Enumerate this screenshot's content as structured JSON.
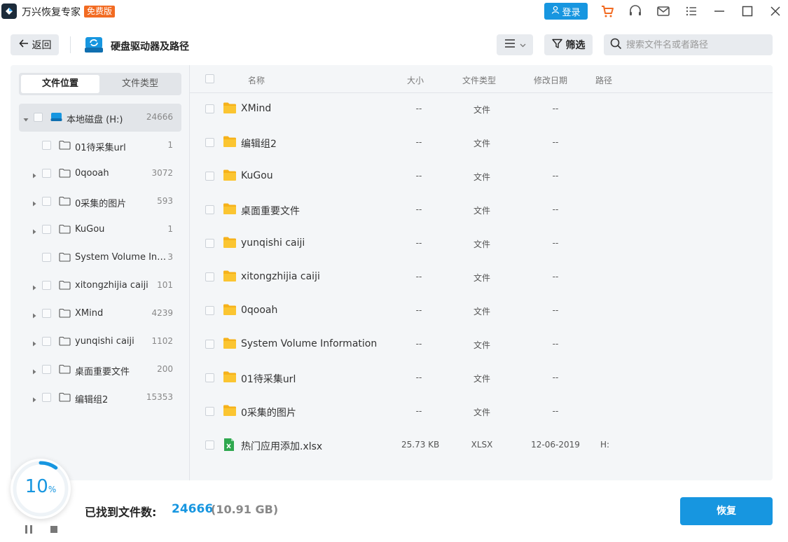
{
  "app": {
    "name": "万兴恢复专家",
    "badge": "免费版",
    "login_label": "登录"
  },
  "toolbar": {
    "back_label": "返回",
    "title": "硬盘驱动器及路径",
    "filter_label": "筛选",
    "search_placeholder": "搜索文件名或者路径"
  },
  "tabs": [
    {
      "label": "文件位置",
      "active": true
    },
    {
      "label": "文件类型",
      "active": false
    }
  ],
  "tree": {
    "root": {
      "label": "本地磁盘 (H:)",
      "count": "24666",
      "expanded": true
    },
    "items": [
      {
        "label": "01待采集url",
        "count": "1",
        "has_children": false
      },
      {
        "label": "0qooah",
        "count": "3072",
        "has_children": true
      },
      {
        "label": "0采集的图片",
        "count": "593",
        "has_children": true
      },
      {
        "label": "KuGou",
        "count": "1",
        "has_children": true
      },
      {
        "label": "System Volume Infor...",
        "count": "3",
        "has_children": false
      },
      {
        "label": "xitongzhijia caiji",
        "count": "101",
        "has_children": true
      },
      {
        "label": "XMind",
        "count": "4239",
        "has_children": true
      },
      {
        "label": "yunqishi caiji",
        "count": "1102",
        "has_children": true
      },
      {
        "label": "桌面重要文件",
        "count": "200",
        "has_children": true
      },
      {
        "label": "编辑组2",
        "count": "15353",
        "has_children": true
      }
    ]
  },
  "table": {
    "headers": {
      "name": "名称",
      "size": "大小",
      "type": "文件类型",
      "date": "修改日期",
      "path": "路径"
    },
    "rows": [
      {
        "icon": "folder-icon",
        "name": "XMind",
        "size": "--",
        "type": "文件",
        "date": "--",
        "path": ""
      },
      {
        "icon": "folder-icon",
        "name": "编辑组2",
        "size": "--",
        "type": "文件",
        "date": "--",
        "path": ""
      },
      {
        "icon": "folder-icon",
        "name": "KuGou",
        "size": "--",
        "type": "文件",
        "date": "--",
        "path": ""
      },
      {
        "icon": "folder-icon",
        "name": "桌面重要文件",
        "size": "--",
        "type": "文件",
        "date": "--",
        "path": ""
      },
      {
        "icon": "folder-icon",
        "name": "yunqishi caiji",
        "size": "--",
        "type": "文件",
        "date": "--",
        "path": ""
      },
      {
        "icon": "folder-icon",
        "name": "xitongzhijia caiji",
        "size": "--",
        "type": "文件",
        "date": "--",
        "path": ""
      },
      {
        "icon": "folder-icon",
        "name": "0qooah",
        "size": "--",
        "type": "文件",
        "date": "--",
        "path": ""
      },
      {
        "icon": "folder-icon",
        "name": "System Volume Information",
        "size": "--",
        "type": "文件",
        "date": "--",
        "path": ""
      },
      {
        "icon": "folder-icon",
        "name": "01待采集url",
        "size": "--",
        "type": "文件",
        "date": "--",
        "path": ""
      },
      {
        "icon": "folder-icon",
        "name": "0采集的图片",
        "size": "--",
        "type": "文件",
        "date": "--",
        "path": ""
      },
      {
        "icon": "excel-file-icon",
        "name": "热门应用添加.xlsx",
        "size": "25.73 KB",
        "type": "XLSX",
        "date": "12-06-2019",
        "path": "H:"
      }
    ]
  },
  "progress": {
    "value": "10",
    "unit": "%",
    "fraction": 0.1
  },
  "footer": {
    "found_label": "已找到文件数:",
    "found_count": "24666",
    "found_size": "(10.91 GB)",
    "recover_label": "恢复"
  },
  "colors": {
    "accent": "#1796e0",
    "badge": "#f26b22",
    "folder": "#f6b21b",
    "cart": "#f26b22"
  }
}
